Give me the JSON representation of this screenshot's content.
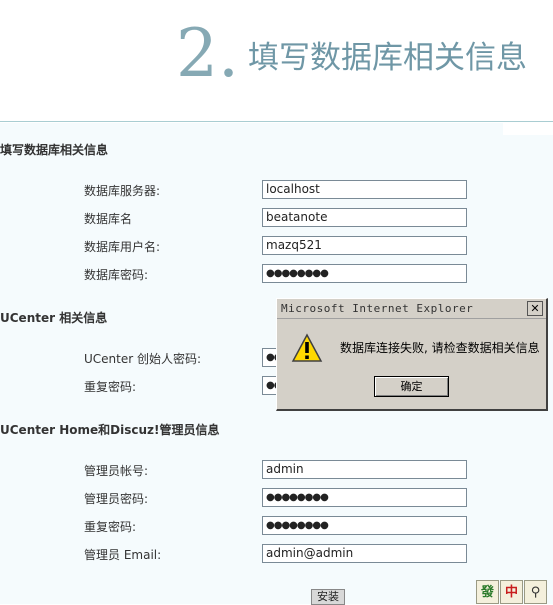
{
  "header": {
    "step_number": "2.",
    "step_title": "填写数据库相关信息"
  },
  "sections": {
    "database": {
      "title": "填写数据库相关信息",
      "fields": [
        {
          "label": "数据库服务器:",
          "value": "localhost"
        },
        {
          "label": "数据库名",
          "value": "beatanote"
        },
        {
          "label": "数据库用户名:",
          "value": "mazq521"
        },
        {
          "label": "数据库密码:",
          "value": "●●●●●●●●"
        }
      ]
    },
    "ucenter": {
      "title": "UCenter 相关信息",
      "fields": [
        {
          "label": "UCenter 创始人密码:",
          "value": "●●"
        },
        {
          "label": "重复密码:",
          "value": "●●"
        }
      ]
    },
    "admin": {
      "title": "UCenter Home和Discuz!管理员信息",
      "fields": [
        {
          "label": "管理员帐号:",
          "value": "admin"
        },
        {
          "label": "管理员密码:",
          "value": "●●●●●●●●"
        },
        {
          "label": "重复密码:",
          "value": "●●●●●●●●"
        },
        {
          "label": "管理员 Email:",
          "value": "admin@admin"
        }
      ]
    }
  },
  "install_button": "安装",
  "taskbar_tiles": [
    "發",
    "中",
    "⚲"
  ],
  "dialog": {
    "title": "Microsoft Internet Explorer",
    "close": "✕",
    "message": "数据库连接失败, 请检查数据相关信息",
    "ok": "确定",
    "icon": "warning-icon"
  }
}
